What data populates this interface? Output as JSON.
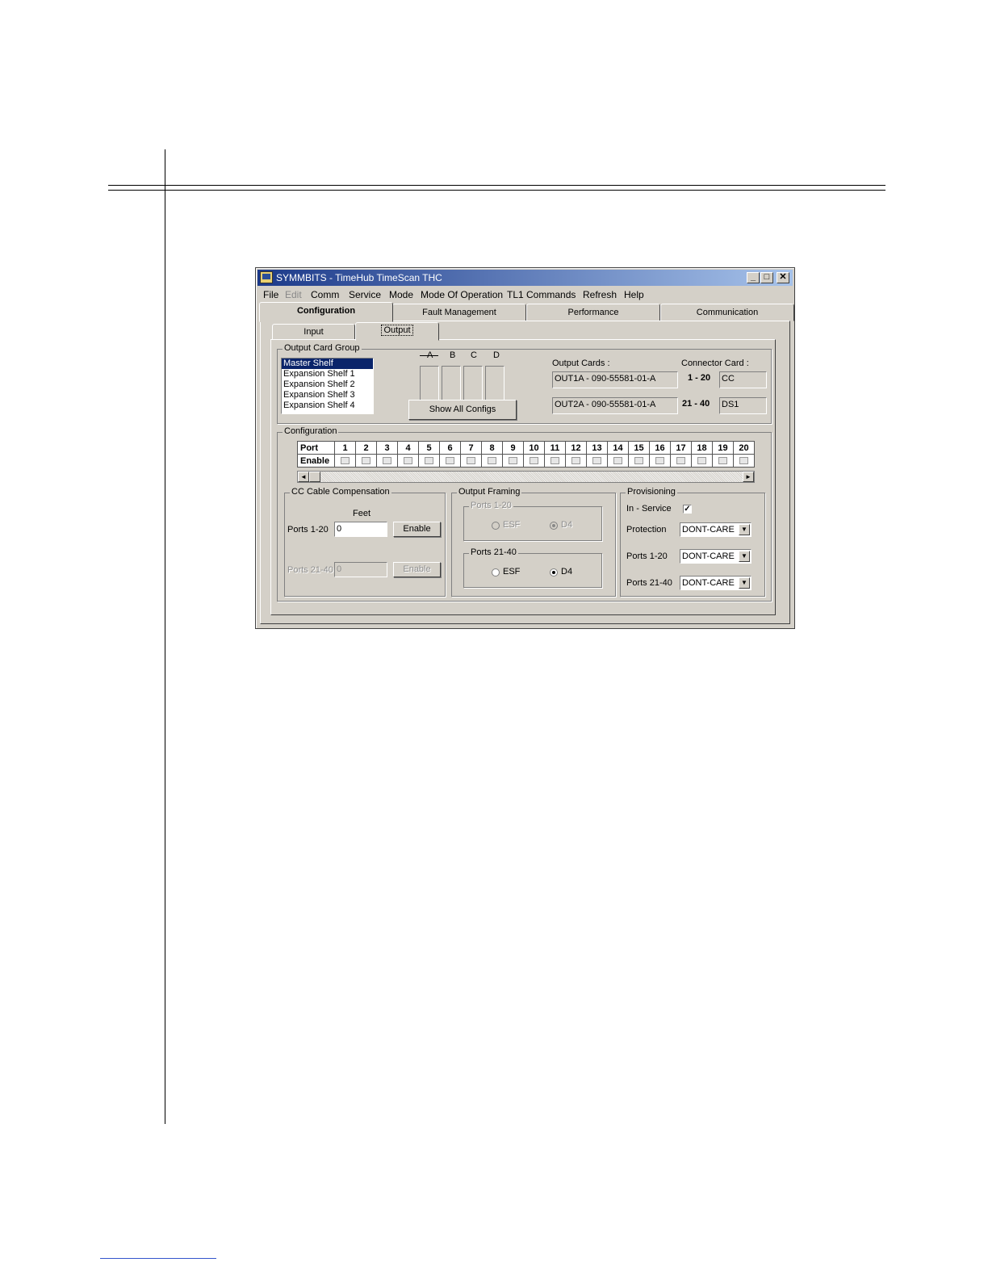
{
  "window": {
    "title": "SYMMBITS - TimeHub TimeScan THC",
    "minimize": "_",
    "maximize": "□",
    "close": "✕"
  },
  "menu": [
    "File",
    "Edit",
    "Comm",
    "Service",
    "Mode",
    "Mode Of Operation",
    "TL1 Commands",
    "Refresh",
    "Help"
  ],
  "main_tabs": [
    "Configuration",
    "Fault Management",
    "Performance",
    "Communication"
  ],
  "sub_tabs": [
    "Input",
    "Output"
  ],
  "output_card_group": {
    "label": "Output Card Group",
    "shelves": [
      "Master Shelf",
      "Expansion Shelf 1",
      "Expansion Shelf 2",
      "Expansion Shelf 3",
      "Expansion Shelf 4"
    ],
    "selected": "Master Shelf",
    "slots": [
      "A",
      "B",
      "C",
      "D"
    ],
    "show_all_button": "Show All Configs",
    "output_cards_label": "Output Cards :",
    "output_card_1": "OUT1A - 090-55581-01-A",
    "output_card_2": "OUT2A - 090-55581-01-A",
    "connector_card_label": "Connector Card :",
    "range_1": "1 - 20",
    "range_2": "21 - 40",
    "connector_1": "CC",
    "connector_2": "DS1"
  },
  "configuration": {
    "label": "Configuration",
    "port_label": "Port",
    "enable_label": "Enable",
    "ports": [
      "1",
      "2",
      "3",
      "4",
      "5",
      "6",
      "7",
      "8",
      "9",
      "10",
      "11",
      "12",
      "13",
      "14",
      "15",
      "16",
      "17",
      "18",
      "19",
      "20"
    ],
    "scroll_left": "◄",
    "scroll_right": "►"
  },
  "cc_cable": {
    "label": "CC Cable Compensation",
    "feet_label": "Feet",
    "ports_1_20_label": "Ports 1-20",
    "ports_1_20_value": "0",
    "ports_21_40_label": "Ports 21-40",
    "ports_21_40_value": "0",
    "enable_button": "Enable"
  },
  "output_framing": {
    "label": "Output Framing",
    "ports_1_20_label": "Ports 1-20",
    "ports_21_40_label": "Ports 21-40",
    "esf": "ESF",
    "d4": "D4"
  },
  "provisioning": {
    "label": "Provisioning",
    "in_service_label": "In - Service",
    "in_service_check": "✓",
    "protection_label": "Protection",
    "protection_value": "DONT-CARE",
    "ports_1_20_label": "Ports 1-20",
    "ports_1_20_value": "DONT-CARE",
    "ports_21_40_label": "Ports 21-40",
    "ports_21_40_value": "DONT-CARE",
    "dropdown_arrow": "▼"
  }
}
